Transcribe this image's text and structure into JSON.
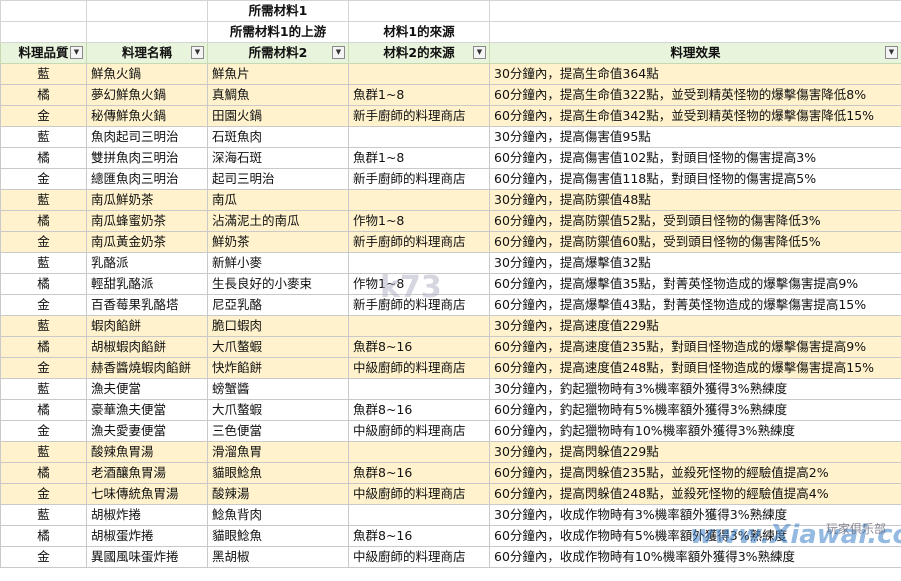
{
  "header": {
    "r1": [
      "",
      "",
      "所需材料1",
      "",
      ""
    ],
    "r2": [
      "",
      "",
      "所需材料1的上游",
      "材料1的來源",
      ""
    ],
    "r3": [
      "料理品質",
      "料理名稱",
      "所需材料2",
      "材料2的來源",
      "料理效果"
    ]
  },
  "rows": [
    {
      "q": "藍",
      "name": "鮮魚火鍋",
      "mat": "鮮魚片",
      "src": "",
      "eff": "30分鐘內，提高生命值364點",
      "hl": true
    },
    {
      "q": "橘",
      "name": "夢幻鮮魚火鍋",
      "mat": "真鯛魚",
      "src": "魚群1~8",
      "eff": "60分鐘內，提高生命值322點，並受到精英怪物的爆擊傷害降低8%",
      "hl": true
    },
    {
      "q": "金",
      "name": "秘傳鮮魚火鍋",
      "mat": "田園火鍋",
      "src": "新手廚師的料理商店",
      "eff": "60分鐘內，提高生命值342點，並受到精英怪物的爆擊傷害降低15%",
      "hl": true
    },
    {
      "q": "藍",
      "name": "魚肉起司三明治",
      "mat": "石斑魚肉",
      "src": "",
      "eff": "30分鐘內，提高傷害值95點",
      "hl": false
    },
    {
      "q": "橘",
      "name": "雙拼魚肉三明治",
      "mat": "深海石斑",
      "src": "魚群1~8",
      "eff": "60分鐘內，提高傷害值102點，對頭目怪物的傷害提高3%",
      "hl": false
    },
    {
      "q": "金",
      "name": "總匯魚肉三明治",
      "mat": "起司三明治",
      "src": "新手廚師的料理商店",
      "eff": "60分鐘內，提高傷害值118點，對頭目怪物的傷害提高5%",
      "hl": false
    },
    {
      "q": "藍",
      "name": "南瓜鮮奶茶",
      "mat": "南瓜",
      "src": "",
      "eff": "30分鐘內，提高防禦值48點",
      "hl": true
    },
    {
      "q": "橘",
      "name": "南瓜蜂蜜奶茶",
      "mat": "沾滿泥土的南瓜",
      "src": "作物1~8",
      "eff": "60分鐘內，提高防禦值52點，受到頭目怪物的傷害降低3%",
      "hl": true
    },
    {
      "q": "金",
      "name": "南瓜黃金奶茶",
      "mat": "鮮奶茶",
      "src": "新手廚師的料理商店",
      "eff": "60分鐘內，提高防禦值60點，受到頭目怪物的傷害降低5%",
      "hl": true
    },
    {
      "q": "藍",
      "name": "乳酪派",
      "mat": "新鮮小麥",
      "src": "",
      "eff": "30分鐘內，提高爆擊值32點",
      "hl": false
    },
    {
      "q": "橘",
      "name": "輕甜乳酪派",
      "mat": "生長良好的小麥束",
      "src": "作物1~8",
      "eff": "60分鐘內，提高爆擊值35點，對菁英怪物造成的爆擊傷害提高9%",
      "hl": false
    },
    {
      "q": "金",
      "name": "百香莓果乳酪塔",
      "mat": "尼亞乳酪",
      "src": "新手廚師的料理商店",
      "eff": "60分鐘內，提高爆擊值43點，對菁英怪物造成的爆擊傷害提高15%",
      "hl": false
    },
    {
      "q": "藍",
      "name": "蝦肉餡餅",
      "mat": "脆口蝦肉",
      "src": "",
      "eff": "30分鐘內，提高速度值229點",
      "hl": true
    },
    {
      "q": "橘",
      "name": "胡椒蝦肉餡餅",
      "mat": "大爪螯蝦",
      "src": "魚群8~16",
      "eff": "60分鐘內，提高速度值235點，對頭目怪物造成的爆擊傷害提高9%",
      "hl": true
    },
    {
      "q": "金",
      "name": "赫香醬燒蝦肉餡餅",
      "mat": "快炸餡餅",
      "src": "中級廚師的料理商店",
      "eff": "60分鐘內，提高速度值248點，對頭目怪物造成的爆擊傷害提高15%",
      "hl": true
    },
    {
      "q": "藍",
      "name": "漁夫便當",
      "mat": "螃蟹醬",
      "src": "",
      "eff": "30分鐘內，釣起獵物時有3%機率額外獲得3%熟練度",
      "hl": false
    },
    {
      "q": "橘",
      "name": "豪華漁夫便當",
      "mat": "大爪螯蝦",
      "src": "魚群8~16",
      "eff": "60分鐘內，釣起獵物時有5%機率額外獲得3%熟練度",
      "hl": false
    },
    {
      "q": "金",
      "name": "漁夫愛妻便當",
      "mat": "三色便當",
      "src": "中級廚師的料理商店",
      "eff": "60分鐘內，釣起獵物時有10%機率額外獲得3%熟練度",
      "hl": false
    },
    {
      "q": "藍",
      "name": "酸辣魚胃湯",
      "mat": "滑溜魚胃",
      "src": "",
      "eff": "30分鐘內，提高閃躲值229點",
      "hl": true
    },
    {
      "q": "橘",
      "name": "老酒釀魚胃湯",
      "mat": "貓眼鯰魚",
      "src": "魚群8~16",
      "eff": "60分鐘內，提高閃躲值235點，並殺死怪物的經驗值提高2%",
      "hl": true
    },
    {
      "q": "金",
      "name": "七味傳統魚胃湯",
      "mat": "酸辣湯",
      "src": "中級廚師的料理商店",
      "eff": "60分鐘內，提高閃躲值248點，並殺死怪物的經驗值提高4%",
      "hl": true
    },
    {
      "q": "藍",
      "name": "胡椒炸捲",
      "mat": "鯰魚背肉",
      "src": "",
      "eff": "30分鐘內，收成作物時有3%機率額外獲得3%熟練度",
      "hl": false
    },
    {
      "q": "橘",
      "name": "胡椒蛋炸捲",
      "mat": "貓眼鯰魚",
      "src": "魚群8~16",
      "eff": "60分鐘內，收成作物時有5%機率額外獲得3%熟練度",
      "hl": false
    },
    {
      "q": "金",
      "name": "異國風味蛋炸捲",
      "mat": "黑胡椒",
      "src": "中級廚師的料理商店",
      "eff": "60分鐘內，收成作物時有10%機率額外獲得3%熟練度",
      "hl": false
    }
  ],
  "watermarks": {
    "k73": "k73",
    "xiawai": "www.Xiawai.com",
    "club": "玩家俱乐部"
  }
}
